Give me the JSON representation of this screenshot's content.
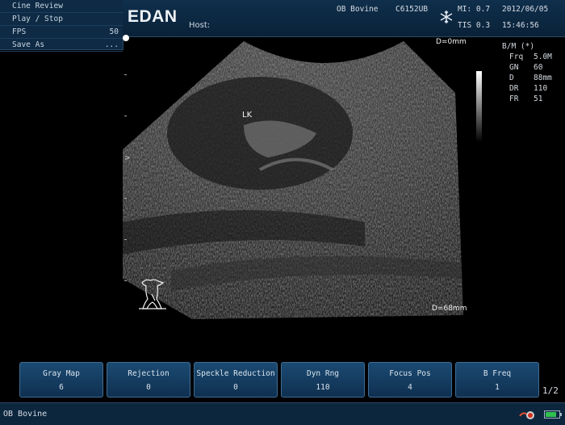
{
  "cine_menu": {
    "items": [
      {
        "label": "Cine Review",
        "value": ""
      },
      {
        "label": "Play / Stop",
        "value": ""
      },
      {
        "label": "FPS",
        "value": "50"
      },
      {
        "label": "Save As",
        "value": "..."
      }
    ]
  },
  "header": {
    "logo": "EDAN",
    "host_label": "Host:",
    "exam_preset": "OB Bovine",
    "probe": "C6152UB",
    "mi": "MI: 0.7",
    "tis": "TIS 0.3",
    "date": "2012/06/05",
    "time": "15:46:56",
    "freeze_icon": "snowflake-icon"
  },
  "image": {
    "depth_top": "D=0mm",
    "depth_bottom": "D=68mm",
    "annotation": "LK",
    "body_mark_icon": "cow-body-mark-icon"
  },
  "params": {
    "mode": "B/M (*)",
    "rows": [
      {
        "key": "Frq",
        "value": "5.0M"
      },
      {
        "key": "GN",
        "value": "60"
      },
      {
        "key": "D",
        "value": "88mm"
      },
      {
        "key": "DR",
        "value": "110"
      },
      {
        "key": "FR",
        "value": "51"
      }
    ]
  },
  "menu": {
    "buttons": [
      {
        "label": "Gray Map",
        "value": "6"
      },
      {
        "label": "Rejection",
        "value": "0"
      },
      {
        "label": "Speckle Reduction",
        "value": "0"
      },
      {
        "label": "Dyn Rng",
        "value": "110"
      },
      {
        "label": "Focus Pos",
        "value": "4"
      },
      {
        "label": "B Freq",
        "value": "1"
      }
    ],
    "page": "1/2"
  },
  "status": {
    "exam_name": "OB Bovine",
    "network_icon": "network-icon",
    "battery_icon": "battery-icon",
    "battery_level": 0.8
  },
  "colors": {
    "panel_bg": "#0e2a44",
    "button_bg": "#1b4a72",
    "battery_green": "#30c050"
  }
}
